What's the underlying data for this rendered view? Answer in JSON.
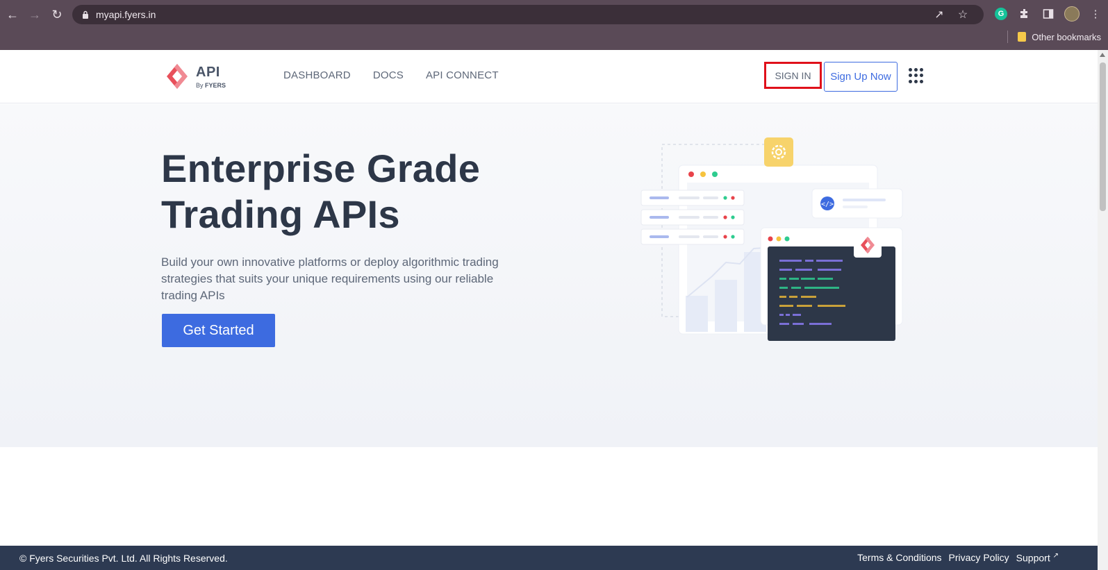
{
  "browser": {
    "url": "myapi.fyers.in",
    "bookmarks_folder": "Other bookmarks",
    "grammarly_letter": "G"
  },
  "header": {
    "logo_title": "API",
    "logo_by": "By",
    "logo_brand": "FYERS",
    "menu": [
      {
        "label": "DASHBOARD"
      },
      {
        "label": "DOCS"
      },
      {
        "label": "API CONNECT"
      }
    ],
    "sign_in": "SIGN IN",
    "sign_up": "Sign Up Now"
  },
  "hero": {
    "title_line1": "Enterprise Grade",
    "title_line2": "Trading APIs",
    "subtitle": "Build your own innovative platforms or deploy algorithmic trading strategies that suits your unique requirements using our reliable trading APIs",
    "cta": "Get Started"
  },
  "footer": {
    "copyright": "© Fyers Securities Pvt. Ltd. All Rights Reserved.",
    "links": [
      {
        "label": "Terms & Conditions"
      },
      {
        "label": "Privacy Policy"
      },
      {
        "label": "Support"
      }
    ],
    "support_arrow": "↗"
  },
  "colors": {
    "accent": "#3d6be0",
    "highlight": "#e0101a",
    "footer_bg": "#2d3a52",
    "title": "#2d3748"
  }
}
